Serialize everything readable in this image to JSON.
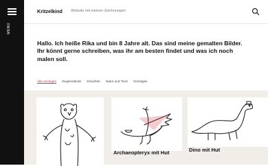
{
  "sidebar": {
    "menu_label": "MENU"
  },
  "header": {
    "title": "Kritzelkind",
    "description": "Website mit meinen Zeichnungen"
  },
  "intro": "Hallo. Ich heiße Rika und bin 8 Jahre alt. Das sind meine gemalten Bilder. Ihr könnt gerne schreiben, was ihr am besten findet und was ich noch malen soll.",
  "filters": [
    "Alle anzeigen",
    "Gegenstände",
    "Gesichter",
    "Natur und Tiere",
    "Sonstiges"
  ],
  "gallery": [
    {
      "caption": ""
    },
    {
      "caption": "Archaeopteryx mit Hut"
    },
    {
      "caption": "Dino mit Hut"
    }
  ],
  "colors": {
    "sidebar": "#111111",
    "accent": "#d0343f",
    "gallery_bg": "#f1eee9"
  },
  "icons": [
    "menu-icon",
    "search-icon"
  ]
}
